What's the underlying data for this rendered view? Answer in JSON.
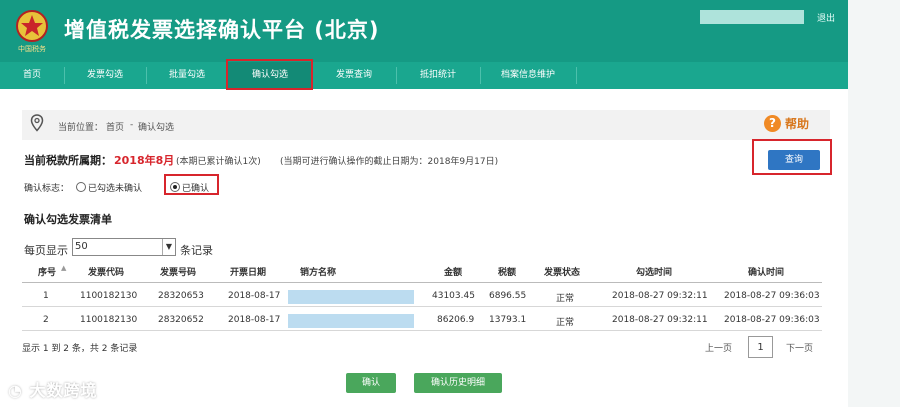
{
  "header": {
    "title": "增值税发票选择确认平台 (北京)",
    "logout": "退出",
    "emblem_text": "中国税务"
  },
  "nav": {
    "items": [
      "首页",
      "发票勾选",
      "批量勾选",
      "确认勾选",
      "发票查询",
      "抵扣统计",
      "档案信息维护"
    ],
    "active_index": 3
  },
  "breadcrumb": {
    "prefix": "当前位置：",
    "home": "首页",
    "sep": "-",
    "current": "确认勾选"
  },
  "help": {
    "label": "帮助"
  },
  "period": {
    "label": "当前税款所属期：",
    "value": "2018年8月",
    "note1": "(本期已累计确认1次)",
    "note2": "(当期可进行确认操作的截止日期为：2018年9月17日)"
  },
  "query_button": "查询",
  "confirm_flag": {
    "label": "确认标志：",
    "options": [
      {
        "label": "已勾选未确认",
        "selected": false
      },
      {
        "label": "已确认",
        "selected": true
      }
    ]
  },
  "list": {
    "title": "确认勾选发票清单",
    "page_size_label": "每页显示",
    "page_size_value": "50",
    "page_size_suffix": "条记录",
    "columns": [
      "序号",
      "发票代码",
      "发票号码",
      "开票日期",
      "销方名称",
      "金额",
      "税额",
      "发票状态",
      "勾选时间",
      "确认时间"
    ],
    "rows": [
      {
        "seq": "1",
        "code": "1100182130",
        "number": "28320653",
        "date": "2018-08-17",
        "seller": "",
        "amount": "43103.45",
        "tax": "6896.55",
        "status": "正常",
        "select_time": "2018-08-27 09:32:11",
        "confirm_time": "2018-08-27 09:36:03"
      },
      {
        "seq": "2",
        "code": "1100182130",
        "number": "28320652",
        "date": "2018-08-17",
        "seller": "",
        "amount": "86206.9",
        "tax": "13793.1",
        "status": "正常",
        "select_time": "2018-08-27 09:32:11",
        "confirm_time": "2018-08-27 09:36:03"
      }
    ],
    "summary": "显示 1 到 2 条，共 2 条记录",
    "pager": {
      "prev": "上一页",
      "page": "1",
      "next": "下一页"
    }
  },
  "actions": {
    "confirm": "确认",
    "history": "确认历史明细"
  },
  "watermark": "大数跨境",
  "colors": {
    "header": "#159a84",
    "nav": "#1aa78f",
    "highlight": "#d7252c",
    "primary": "#2f76c3",
    "success": "#4aa75c"
  }
}
